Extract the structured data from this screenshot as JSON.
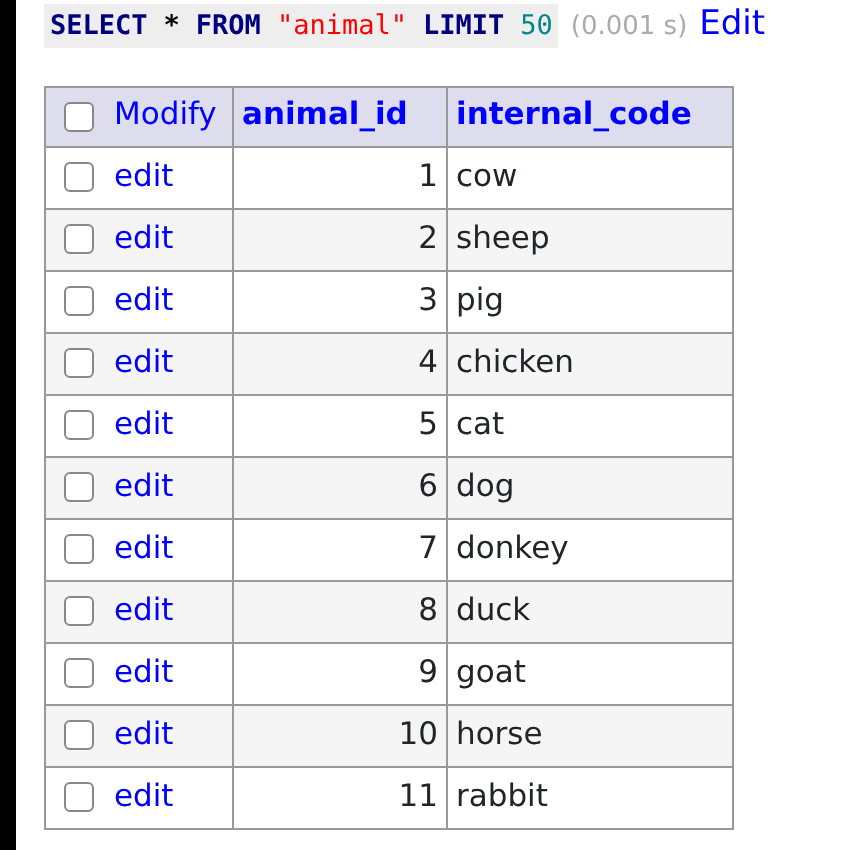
{
  "query": {
    "tokens": [
      {
        "kind": "keyword",
        "text": "SELECT"
      },
      {
        "kind": "plain",
        "text": "*"
      },
      {
        "kind": "keyword",
        "text": "FROM"
      },
      {
        "kind": "string",
        "text": "\"animal\""
      },
      {
        "kind": "keyword",
        "text": "LIMIT"
      },
      {
        "kind": "number",
        "text": "50"
      }
    ],
    "time": "(0.001 s)",
    "edit_link": "Edit"
  },
  "table": {
    "select_all": {
      "checked": false
    },
    "columns": [
      "Modify",
      "animal_id",
      "internal_code"
    ],
    "rows": [
      {
        "checked": false,
        "action": "edit",
        "animal_id": "1",
        "internal_code": "cow"
      },
      {
        "checked": false,
        "action": "edit",
        "animal_id": "2",
        "internal_code": "sheep"
      },
      {
        "checked": false,
        "action": "edit",
        "animal_id": "3",
        "internal_code": "pig"
      },
      {
        "checked": false,
        "action": "edit",
        "animal_id": "4",
        "internal_code": "chicken"
      },
      {
        "checked": false,
        "action": "edit",
        "animal_id": "5",
        "internal_code": "cat"
      },
      {
        "checked": false,
        "action": "edit",
        "animal_id": "6",
        "internal_code": "dog"
      },
      {
        "checked": false,
        "action": "edit",
        "animal_id": "7",
        "internal_code": "donkey"
      },
      {
        "checked": false,
        "action": "edit",
        "animal_id": "8",
        "internal_code": "duck"
      },
      {
        "checked": false,
        "action": "edit",
        "animal_id": "9",
        "internal_code": "goat"
      },
      {
        "checked": false,
        "action": "edit",
        "animal_id": "10",
        "internal_code": "horse"
      },
      {
        "checked": false,
        "action": "edit",
        "animal_id": "11",
        "internal_code": "rabbit"
      }
    ]
  }
}
